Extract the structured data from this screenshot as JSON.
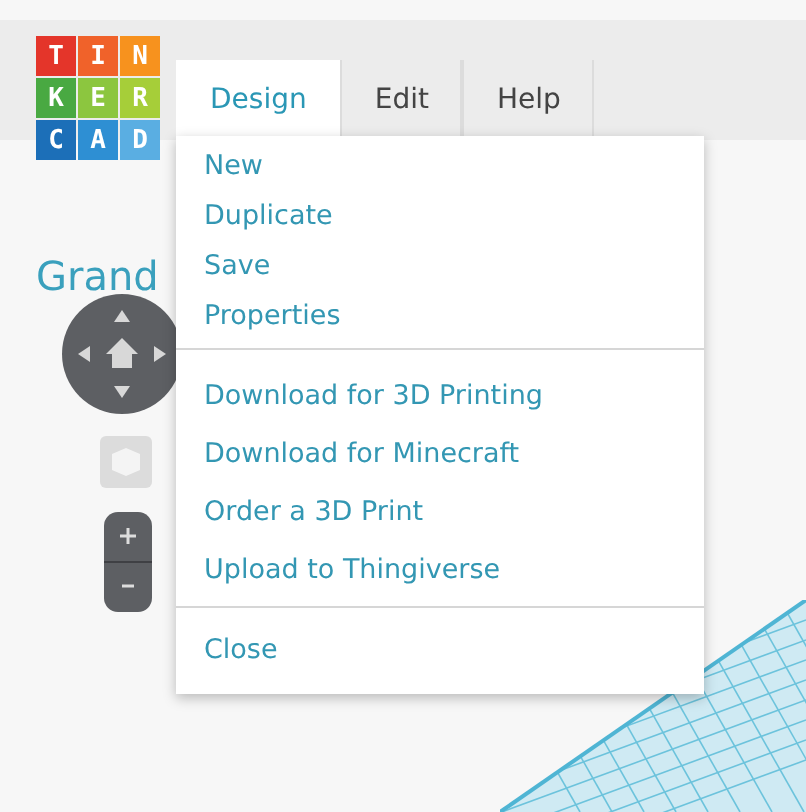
{
  "logo": {
    "tiles": [
      {
        "letter": "T",
        "color": "#e4352a"
      },
      {
        "letter": "I",
        "color": "#f0622a"
      },
      {
        "letter": "N",
        "color": "#f7921e"
      },
      {
        "letter": "K",
        "color": "#49a942"
      },
      {
        "letter": "E",
        "color": "#8cc63f"
      },
      {
        "letter": "R",
        "color": "#a6ce39"
      },
      {
        "letter": "C",
        "color": "#1c6fb8"
      },
      {
        "letter": "A",
        "color": "#2e8fd3"
      },
      {
        "letter": "D",
        "color": "#5aaee2"
      }
    ]
  },
  "menubar": [
    {
      "label": "Design",
      "selected": true
    },
    {
      "label": "Edit",
      "selected": false
    },
    {
      "label": "Help",
      "selected": false
    }
  ],
  "menu": {
    "sections": [
      {
        "items": [
          "New",
          "Duplicate",
          "Save",
          "Properties"
        ]
      },
      {
        "items": [
          "Download for 3D Printing",
          "Download for Minecraft",
          "Order a 3D Print",
          "Upload to Thingiverse"
        ]
      },
      {
        "items": [
          "Close"
        ]
      }
    ]
  },
  "design_title": "Grand"
}
